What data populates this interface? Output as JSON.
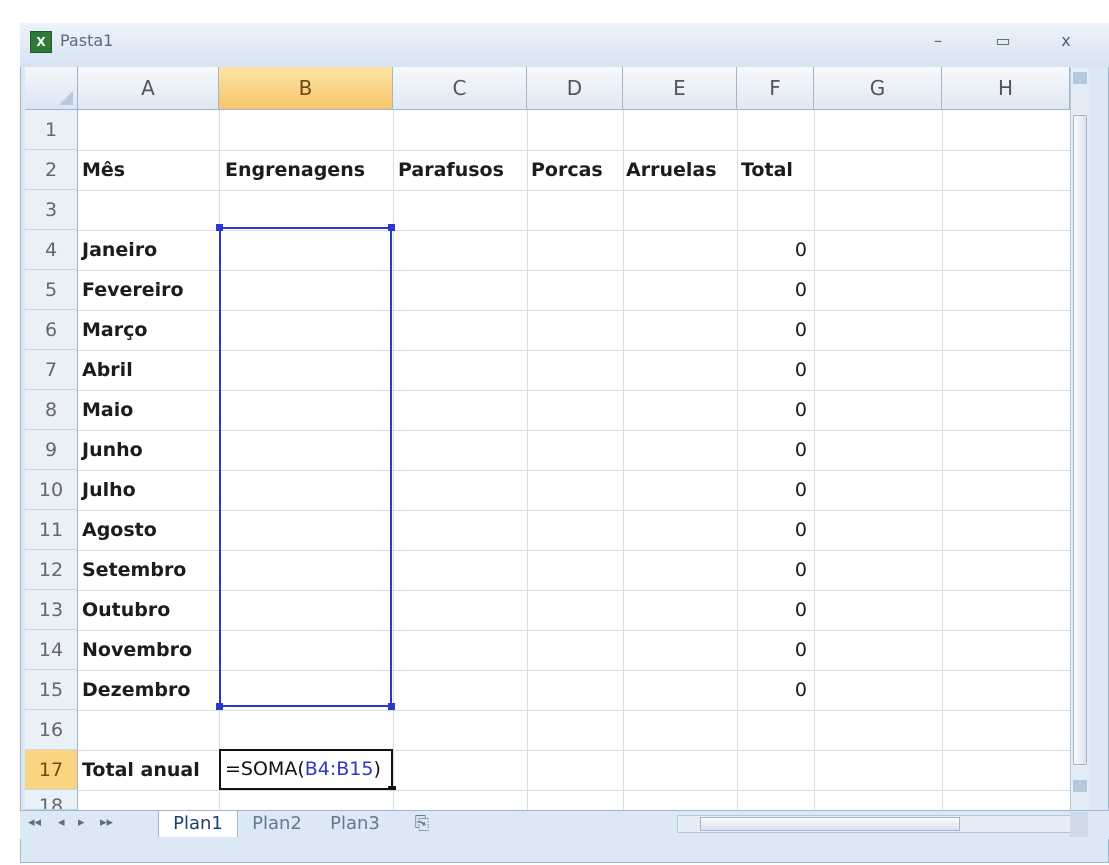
{
  "window": {
    "title": "Pasta1",
    "app_icon": "excel-icon",
    "minimize": "–",
    "restore": "▭",
    "close": "x"
  },
  "columns": [
    "A",
    "B",
    "C",
    "D",
    "E",
    "F",
    "G",
    "H"
  ],
  "active_column": "B",
  "rows": [
    "1",
    "2",
    "3",
    "4",
    "5",
    "6",
    "7",
    "8",
    "9",
    "10",
    "11",
    "12",
    "13",
    "14",
    "15",
    "16",
    "17",
    "18"
  ],
  "active_row": "17",
  "headers": {
    "mes": "Mês",
    "engrenagens": "Engrenagens",
    "parafusos": "Parafusos",
    "porcas": "Porcas",
    "arruelas": "Arruelas",
    "total": "Total"
  },
  "months": [
    "Janeiro",
    "Fevereiro",
    "Março",
    "Abril",
    "Maio",
    "Junho",
    "Julho",
    "Agosto",
    "Setembro",
    "Outubro",
    "Novembro",
    "Dezembro"
  ],
  "totals": [
    "0",
    "0",
    "0",
    "0",
    "0",
    "0",
    "0",
    "0",
    "0",
    "0",
    "0",
    "0"
  ],
  "total_anual_label": "Total anual",
  "formula": {
    "prefix": "=SOMA(",
    "ref": "B4:B15",
    "suffix": ")"
  },
  "sheets": [
    "Plan1",
    "Plan2",
    "Plan3"
  ],
  "active_sheet": "Plan1",
  "nav_icons": [
    "first-sheet-icon",
    "prev-sheet-icon",
    "next-sheet-icon",
    "last-sheet-icon"
  ],
  "new_sheet_icon": "insert-sheet-icon"
}
